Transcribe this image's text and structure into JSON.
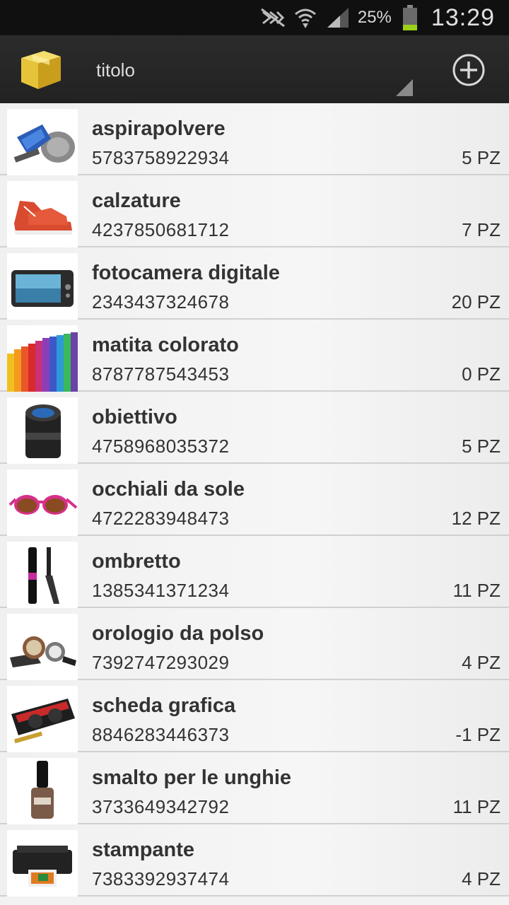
{
  "status_bar": {
    "battery_percent": "25%",
    "time": "13:29",
    "icons": [
      "nfc-off-icon",
      "wifi-icon",
      "signal-icon",
      "battery-icon"
    ]
  },
  "action_bar": {
    "spinner_label": "titolo",
    "icons": [
      "box-logo-icon",
      "add-circle-icon"
    ]
  },
  "items": [
    {
      "name": "aspirapolvere",
      "code": "5783758922934",
      "qty": "5 PZ",
      "icon": "vacuum-cleaner-image"
    },
    {
      "name": "calzature",
      "code": "4237850681712",
      "qty": "7 PZ",
      "icon": "sneakers-image"
    },
    {
      "name": "fotocamera digitale",
      "code": "2343437324678",
      "qty": "20 PZ",
      "icon": "camera-image"
    },
    {
      "name": "matita colorato",
      "code": "8787787543453",
      "qty": "0 PZ",
      "icon": "colored-pencils-image"
    },
    {
      "name": "obiettivo",
      "code": "4758968035372",
      "qty": "5 PZ",
      "icon": "lens-image"
    },
    {
      "name": "occhiali da sole",
      "code": "4722283948473",
      "qty": "12 PZ",
      "icon": "sunglasses-image"
    },
    {
      "name": "ombretto",
      "code": "1385341371234",
      "qty": "11 PZ",
      "icon": "mascara-image"
    },
    {
      "name": "orologio da polso",
      "code": "7392747293029",
      "qty": "4 PZ",
      "icon": "watch-image"
    },
    {
      "name": "scheda grafica",
      "code": "8846283446373",
      "qty": "-1 PZ",
      "icon": "graphics-card-image"
    },
    {
      "name": "smalto per le unghie",
      "code": "3733649342792",
      "qty": "11 PZ",
      "icon": "nail-polish-image"
    },
    {
      "name": "stampante",
      "code": "7383392937474",
      "qty": "4 PZ",
      "icon": "printer-image"
    }
  ]
}
